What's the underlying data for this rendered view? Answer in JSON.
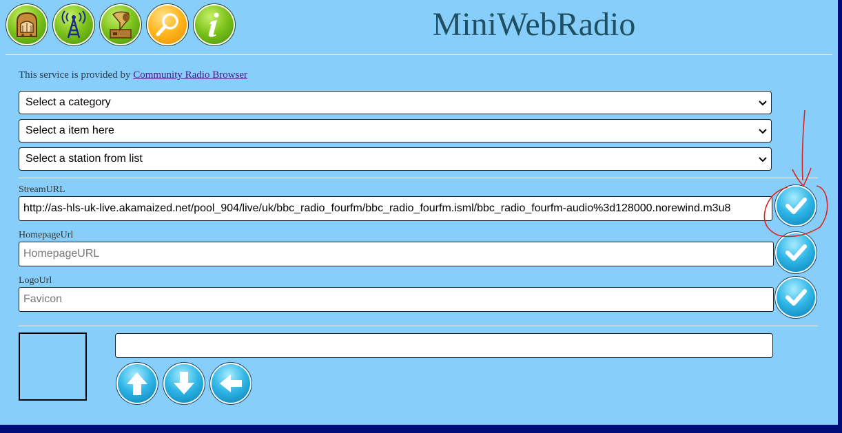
{
  "header": {
    "title": "MiniWebRadio",
    "nav_icons": [
      "radio-icon",
      "antenna-icon",
      "gramophone-icon",
      "search-icon",
      "info-icon"
    ]
  },
  "provider": {
    "prefix": "This service is provided by ",
    "link": "Community Radio Browser"
  },
  "selects": {
    "category": "Select a category",
    "item": "Select a item here",
    "station": "Select a station from list"
  },
  "fields": {
    "stream_label": "StreamURL",
    "stream_value": "http://as-hls-uk-live.akamaized.net/pool_904/live/uk/bbc_radio_fourfm/bbc_radio_fourfm.isml/bbc_radio_fourfm-audio%3d128000.norewind.m3u8",
    "homepage_label": "HomepageUrl",
    "homepage_placeholder": "HomepageURL",
    "logo_label": "LogoUrl",
    "logo_placeholder": "Favicon"
  },
  "bottom": {
    "name_value": ""
  },
  "colors": {
    "background": "#87cefa",
    "title": "#1f4f62",
    "button_blue": "#2fb6e6",
    "annotation_red": "#e0201c"
  }
}
